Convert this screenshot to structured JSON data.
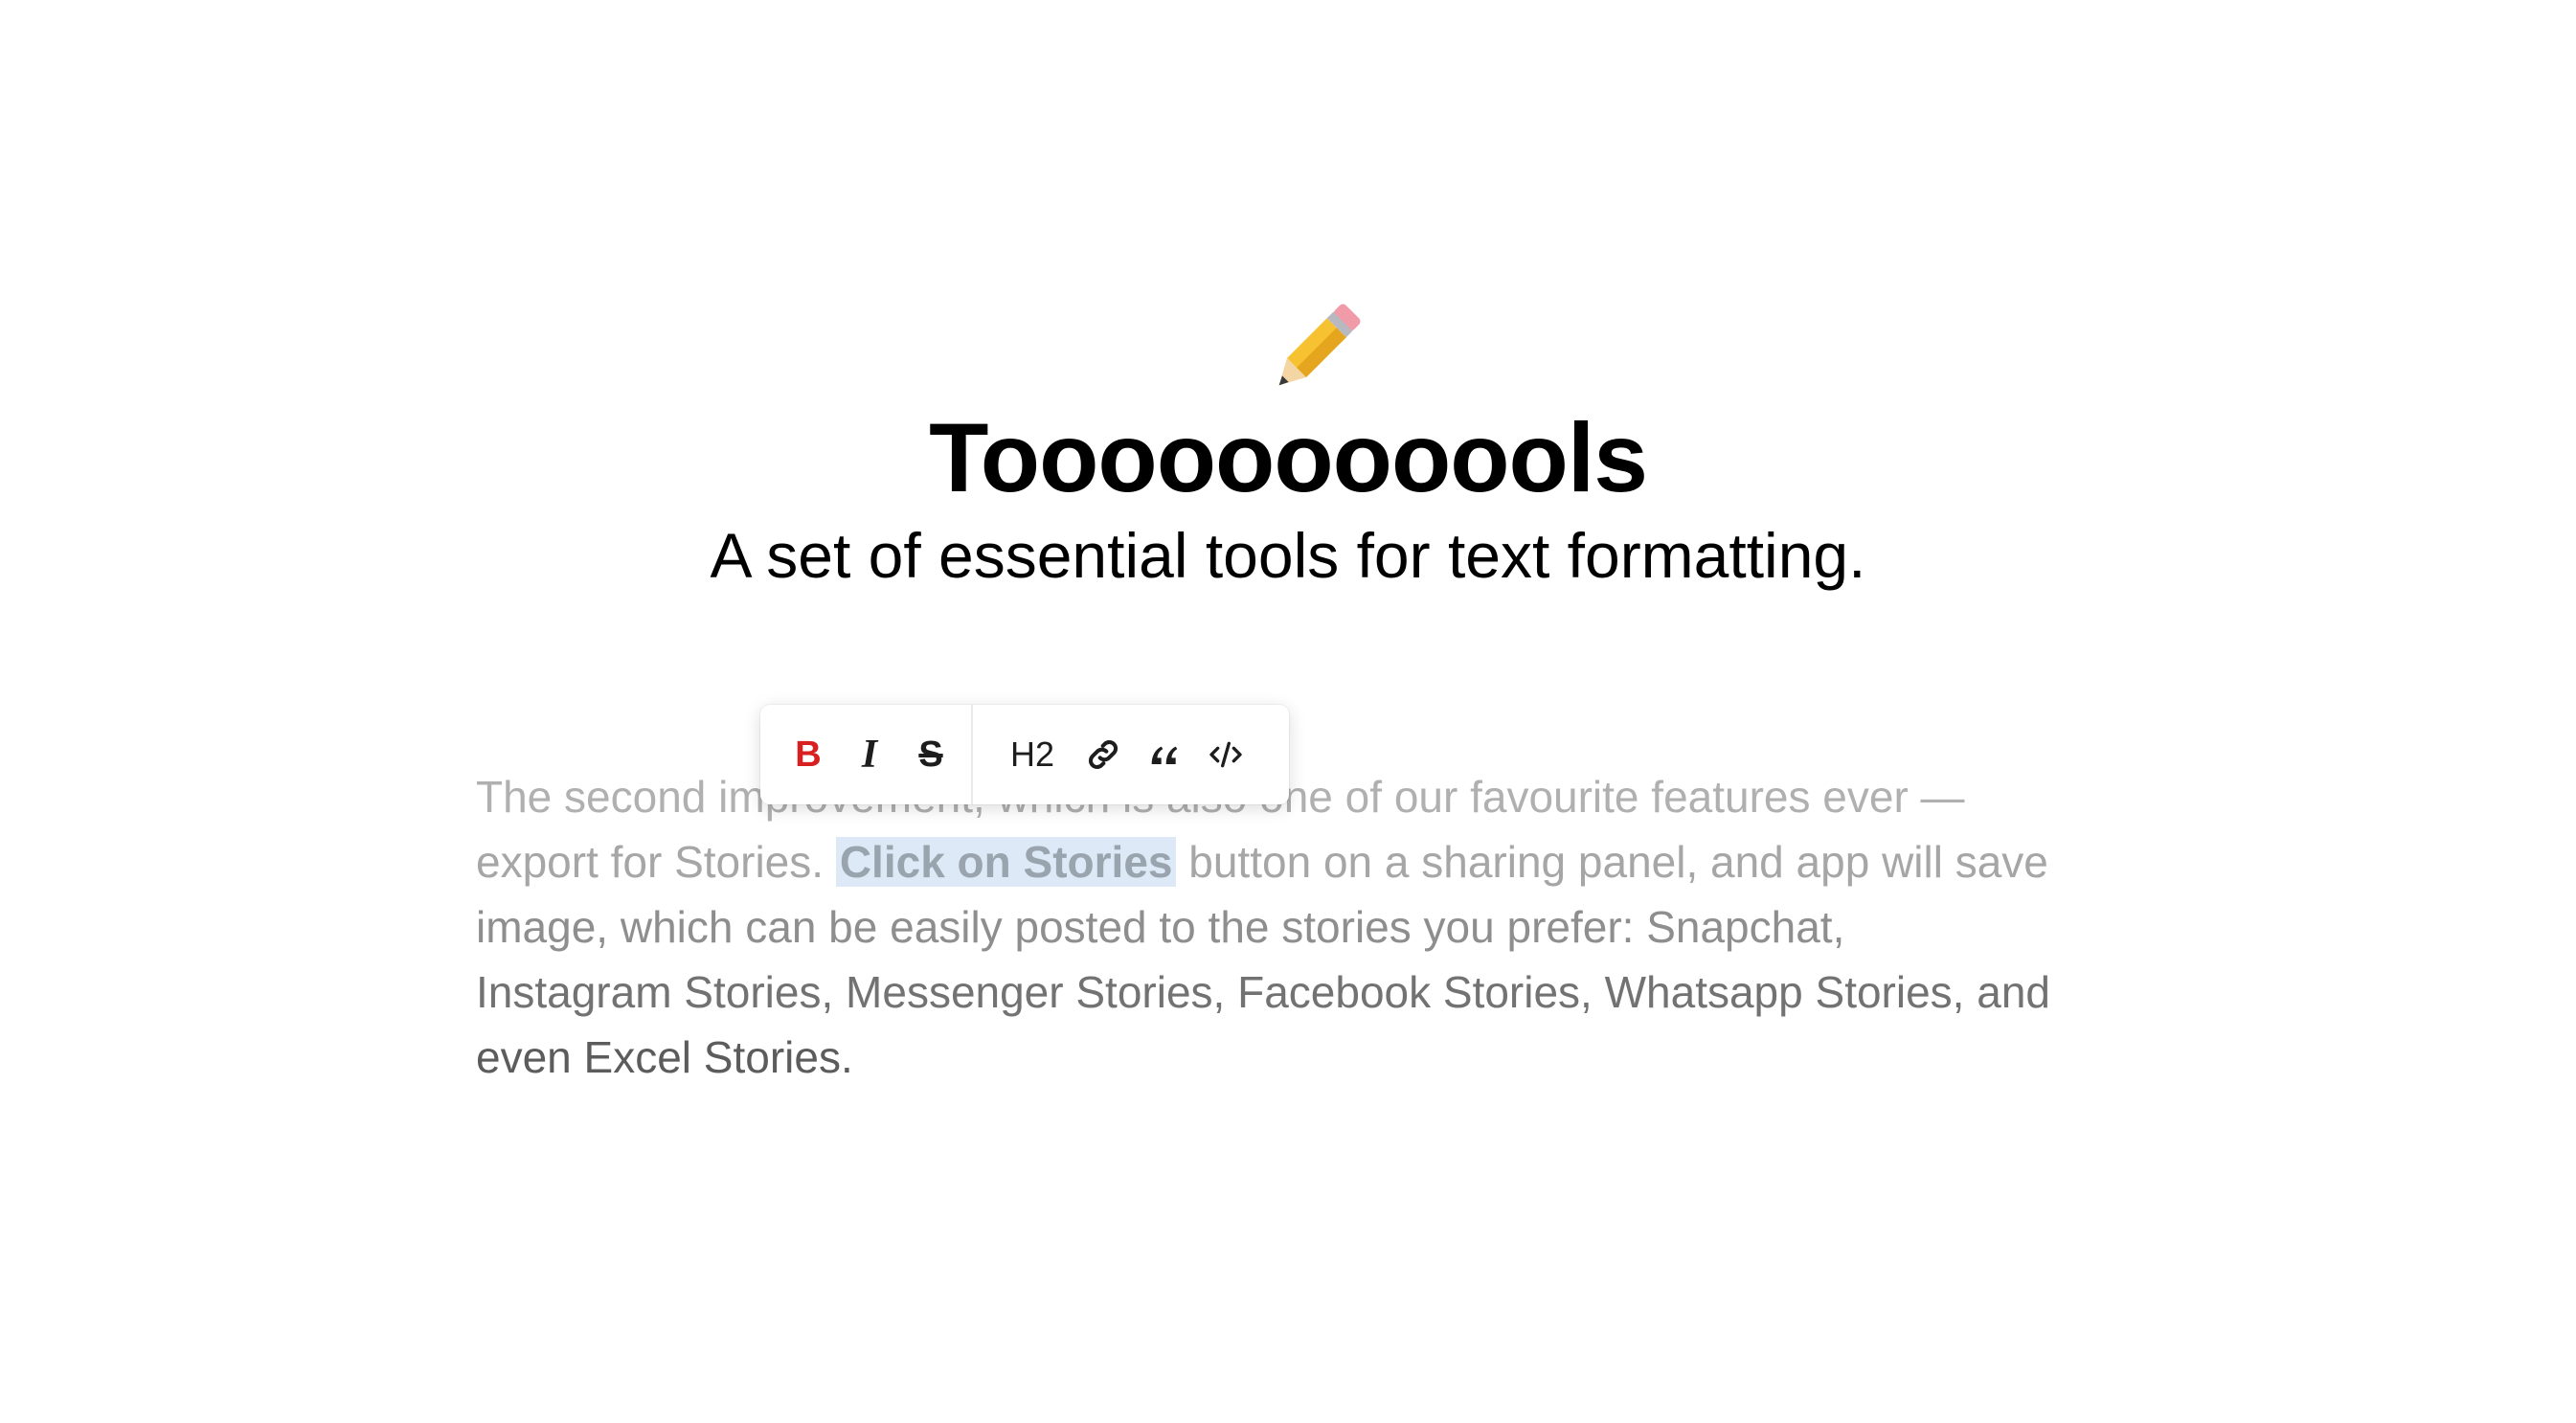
{
  "header": {
    "emoji_icon": "pencil-icon",
    "title": "Tooooooooools",
    "subtitle": "A set of essential tools for text formatting."
  },
  "toolbar": {
    "bold_label": "B",
    "italic_label": "I",
    "strike_label": "S",
    "heading_label": "H2",
    "link_icon": "link-icon",
    "quote_icon": "quote-icon",
    "code_icon": "code-icon",
    "active_color": "#d92020"
  },
  "editor": {
    "line1": "The second improvement, which is also one of our favourite features ever —",
    "line2_before": "export for Stories. ",
    "line2_selected": "Click on Stories",
    "line2_after": " button on a sharing panel, and app will save",
    "line3": "image, which can be easily posted to the stories you prefer: Snapchat,",
    "line4": "Instagram Stories, Messenger Stories, Facebook Stories, Whatsapp Stories, and",
    "line5": "even Excel Stories.",
    "selection_color": "#dde9f6"
  }
}
